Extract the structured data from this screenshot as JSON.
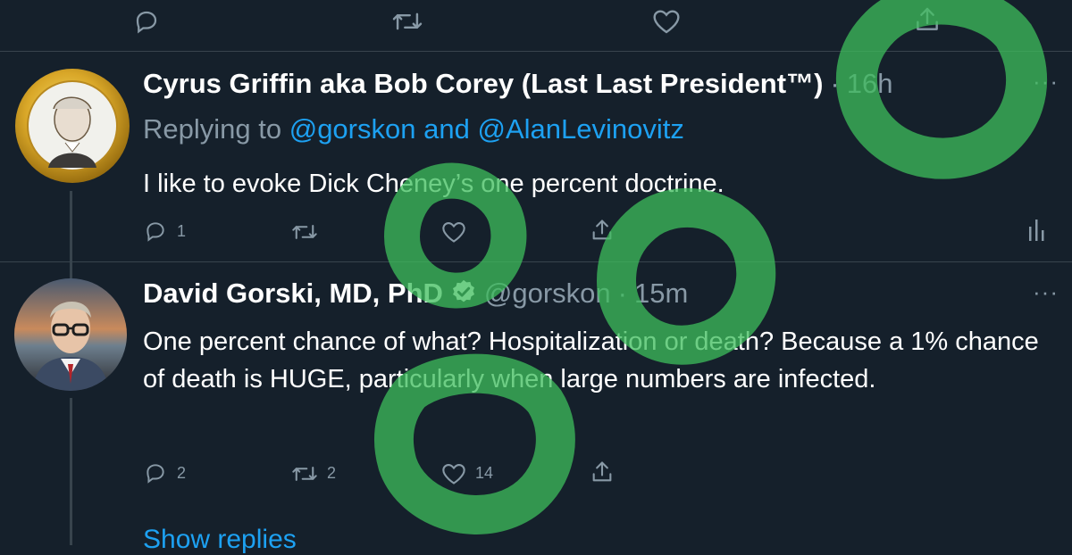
{
  "colors": {
    "background": "#15202b",
    "text": "#ffffff",
    "muted": "#8899a6",
    "link": "#1da1f2",
    "divider": "#38444d",
    "overlay_green": "#3dbe5c"
  },
  "top_actions": {
    "icons": [
      "reply-icon",
      "retweet-icon",
      "like-icon",
      "share-icon"
    ]
  },
  "tweet1": {
    "author_name": "Cyrus Griffin aka Bob Corey (Last Last President™)",
    "separator": "·",
    "time": "16h",
    "replying_prefix": "Replying to",
    "mention1": "@gorskon",
    "and": "and",
    "mention2": "@AlanLevinovitz",
    "text": "I like to evoke Dick Cheney’s one percent doctrine.",
    "reply_count": "1",
    "avatar_icon": "coin-portrait-avatar",
    "more_icon": "more-icon",
    "analytics_icon": "analytics-icon"
  },
  "tweet2": {
    "author_name": "David Gorski, MD, PhD",
    "handle": "@gorskon",
    "separator": "·",
    "time": "15m",
    "text": "One percent chance of what? Hospitalization or death? Because a 1% chance of death is HUGE, particularly when large numbers are infected.",
    "reply_count": "2",
    "retweet_count": "2",
    "like_count": "14",
    "avatar_icon": "photo-avatar",
    "verified_icon": "verified-badge-icon",
    "more_icon": "more-icon"
  },
  "show_replies": "Show replies"
}
